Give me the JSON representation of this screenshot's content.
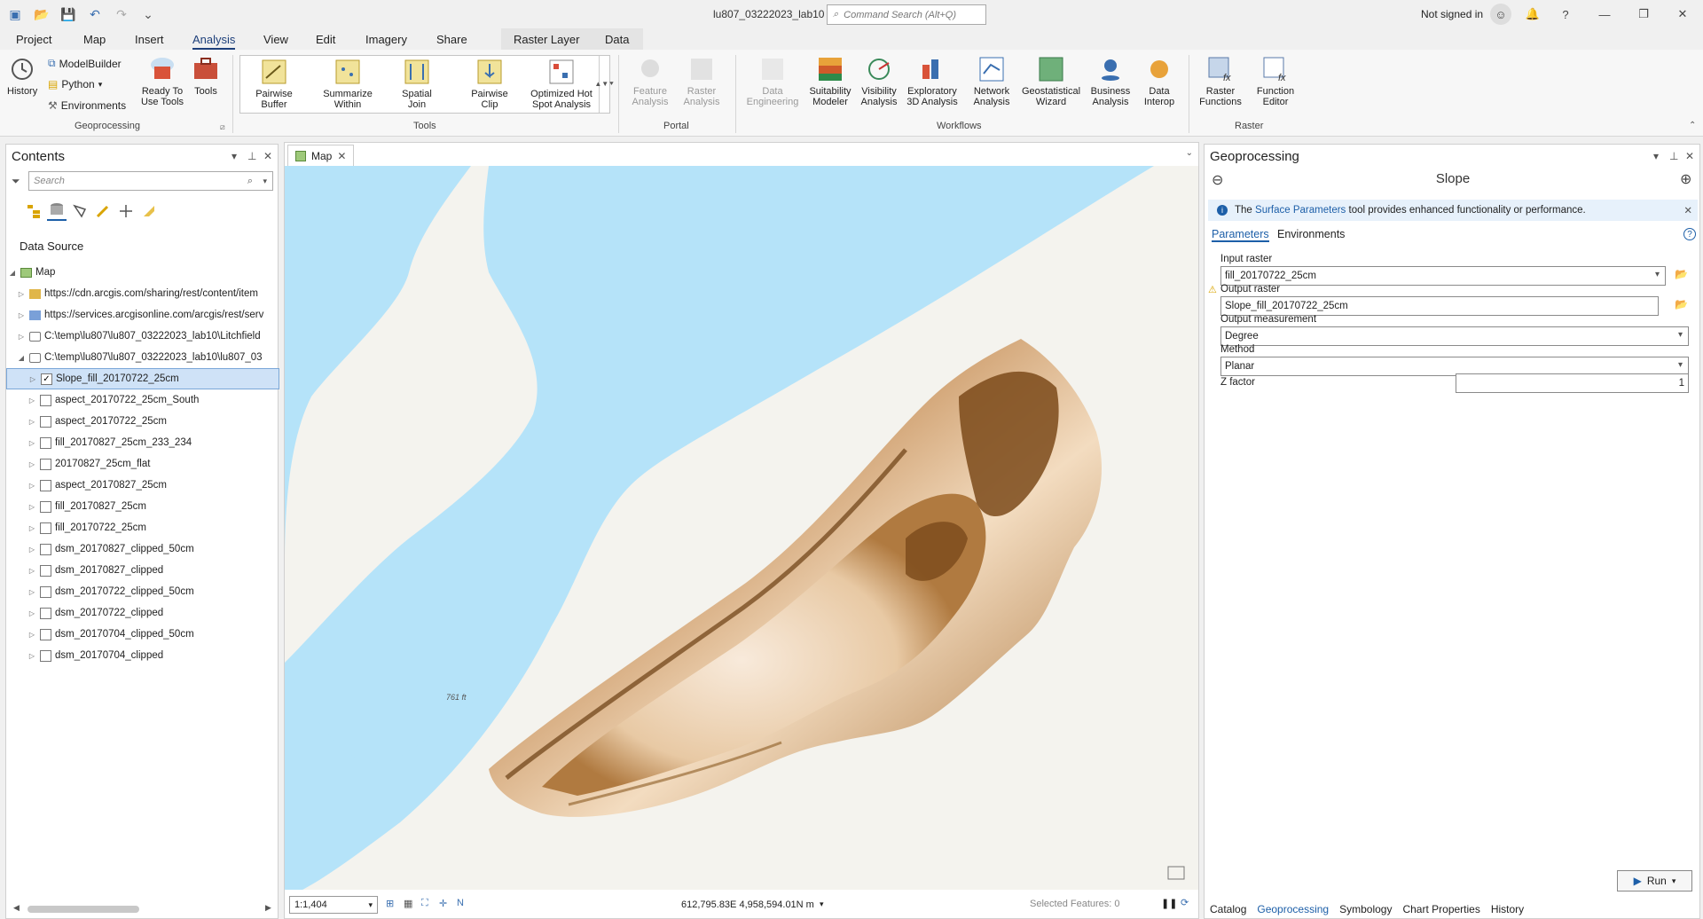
{
  "title_bar": {
    "document_title": "lu807_03222023_lab10",
    "search_placeholder": "Command Search (Alt+Q)",
    "sign_in": "Not signed in"
  },
  "ribbon_tabs": [
    "Project",
    "Map",
    "Insert",
    "Analysis",
    "View",
    "Edit",
    "Imagery",
    "Share",
    "Raster Layer",
    "Data"
  ],
  "active_tab": "Analysis",
  "ribbon": {
    "geoprocessing": {
      "label": "Geoprocessing",
      "history": "History",
      "modelbuilder": "ModelBuilder",
      "python": "Python",
      "environments": "Environments",
      "ready_to_use": "Ready To Use Tools",
      "tools": "Tools"
    },
    "tools": {
      "label": "Tools",
      "items": [
        "Pairwise Buffer",
        "Summarize Within",
        "Spatial Join",
        "Pairwise Clip",
        "Optimized Hot Spot Analysis"
      ]
    },
    "portal": {
      "label": "Portal",
      "items": [
        "Feature Analysis",
        "Raster Analysis"
      ]
    },
    "workflows": {
      "label": "Workflows",
      "items": [
        "Data Engineering",
        "Suitability Modeler",
        "Visibility Analysis",
        "Exploratory 3D Analysis",
        "Network Analysis",
        "Geostatistical Wizard",
        "Business Analysis",
        "Data Interop"
      ]
    },
    "raster": {
      "label": "Raster",
      "items": [
        "Raster Functions",
        "Function Editor"
      ]
    }
  },
  "contents": {
    "title": "Contents",
    "search_placeholder": "Search",
    "section": "Data Source",
    "map_node": "Map",
    "sources": [
      "https://cdn.arcgis.com/sharing/rest/content/item",
      "https://services.arcgisonline.com/arcgis/rest/serv",
      "C:\\temp\\lu807\\lu807_03222023_lab10\\Litchfield",
      "C:\\temp\\lu807\\lu807_03222023_lab10\\lu807_03"
    ],
    "layers": [
      {
        "name": "Slope_fill_20170722_25cm",
        "checked": true,
        "selected": true
      },
      {
        "name": "aspect_20170722_25cm_South",
        "checked": false
      },
      {
        "name": "aspect_20170722_25cm",
        "checked": false
      },
      {
        "name": "fill_20170827_25cm_233_234",
        "checked": false
      },
      {
        "name": "20170827_25cm_flat",
        "checked": false
      },
      {
        "name": "aspect_20170827_25cm",
        "checked": false
      },
      {
        "name": "fill_20170827_25cm",
        "checked": false
      },
      {
        "name": "fill_20170722_25cm",
        "checked": false
      },
      {
        "name": "dsm_20170827_clipped_50cm",
        "checked": false
      },
      {
        "name": "dsm_20170827_clipped",
        "checked": false
      },
      {
        "name": "dsm_20170722_clipped_50cm",
        "checked": false
      },
      {
        "name": "dsm_20170722_clipped",
        "checked": false
      },
      {
        "name": "dsm_20170704_clipped_50cm",
        "checked": false
      },
      {
        "name": "dsm_20170704_clipped",
        "checked": false
      }
    ]
  },
  "map": {
    "tab": "Map",
    "label": "761 ft",
    "scale": "1:1,404",
    "coordinates": "612,795.83E 4,958,594.01N m",
    "selected_features": "Selected Features: 0"
  },
  "geoprocessing": {
    "title": "Geoprocessing",
    "tool": "Slope",
    "info_prefix": "The",
    "info_link": "Surface Parameters",
    "info_suffix": "tool provides enhanced functionality or performance.",
    "tabs": [
      "Parameters",
      "Environments"
    ],
    "params": {
      "input_raster_label": "Input raster",
      "input_raster": "fill_20170722_25cm",
      "output_raster_label": "Output raster",
      "output_raster": "Slope_fill_20170722_25cm",
      "measurement_label": "Output measurement",
      "measurement": "Degree",
      "method_label": "Method",
      "method": "Planar",
      "z_label": "Z factor",
      "z": "1"
    },
    "run": "Run",
    "bottom_tabs": [
      "Catalog",
      "Geoprocessing",
      "Symbology",
      "Chart Properties",
      "History"
    ],
    "bottom_active": "Geoprocessing"
  },
  "colors": {
    "water": "#b5e3f9",
    "land": "#f4f3ee",
    "slope_dark": "#7a4a16",
    "slope_light": "#f7e4cc",
    "accent": "#1d5fa8"
  }
}
